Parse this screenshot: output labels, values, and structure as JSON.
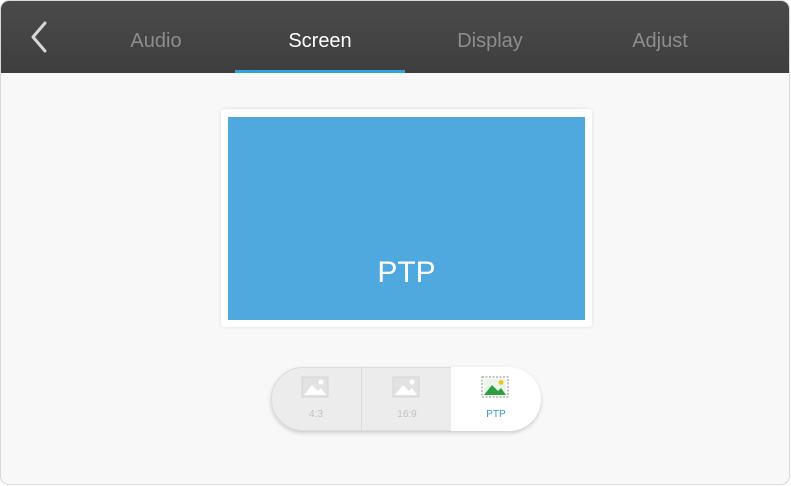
{
  "header": {
    "back_icon": "chevron-left-icon",
    "tabs": [
      {
        "label": "Audio",
        "active": false
      },
      {
        "label": "Screen",
        "active": true
      },
      {
        "label": "Display",
        "active": false
      },
      {
        "label": "Adjust",
        "active": false
      }
    ],
    "accent_color": "#2fa3e0"
  },
  "preview": {
    "label": "PTP",
    "screen_color": "#4fa8de"
  },
  "aspect_selector": {
    "options": [
      {
        "label": "4:3",
        "icon": "image-icon",
        "selected": false
      },
      {
        "label": "16:9",
        "icon": "image-icon",
        "selected": false
      },
      {
        "label": "PTP",
        "icon": "image-icon",
        "selected": true
      }
    ],
    "selected_color": "#2a9ad8"
  }
}
